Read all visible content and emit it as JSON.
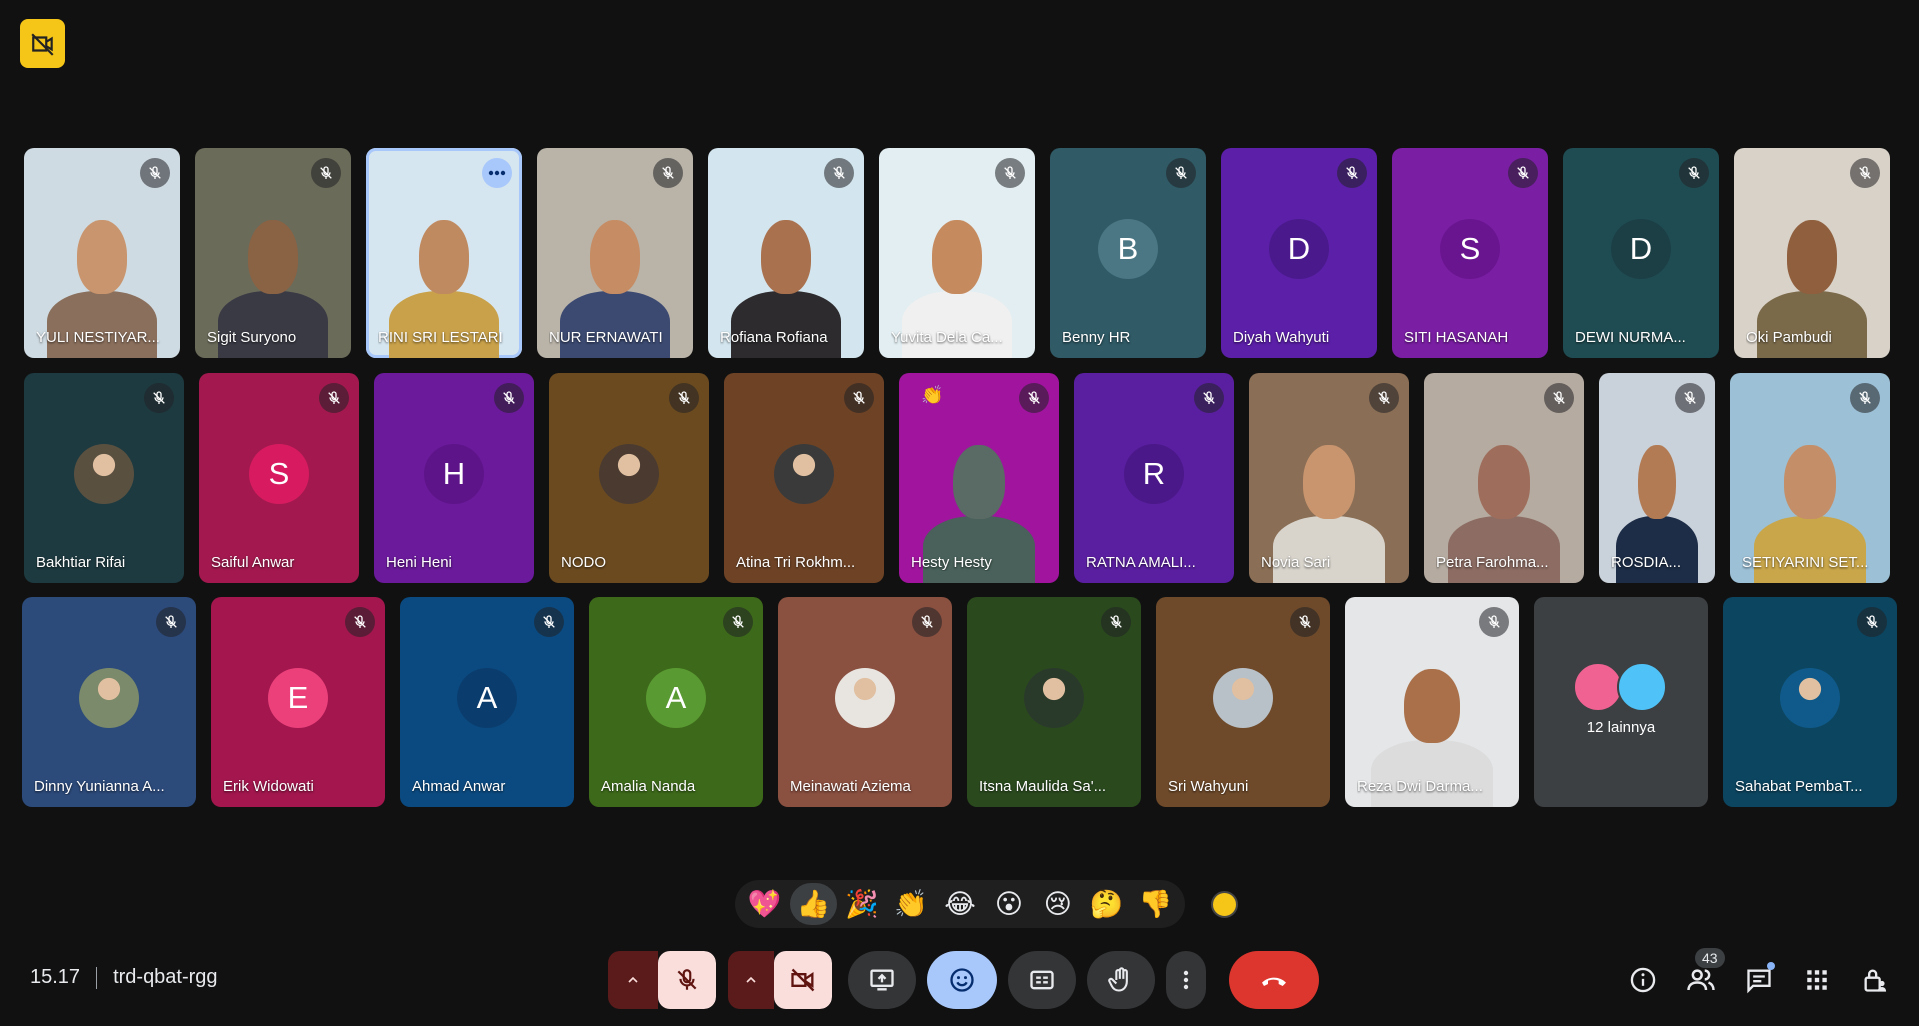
{
  "meeting": {
    "time": "15.17",
    "code": "trd-qbat-rgg"
  },
  "participants_row1": [
    {
      "name": "YULI NESTIYAR...",
      "kind": "video",
      "bg": "#cfdbe2",
      "skin": "#c9956e",
      "cloth": "#8a6f5c"
    },
    {
      "name": "Sigit Suryono",
      "kind": "video",
      "bg": "#6b6b5a",
      "skin": "#8a6244",
      "cloth": "#3a3a45"
    },
    {
      "name": "RINI SRI LESTARI",
      "kind": "video",
      "bg": "#d6e6f0",
      "skin": "#c08a60",
      "cloth": "#c9a14a",
      "active": true
    },
    {
      "name": "NUR ERNAWATI",
      "kind": "video",
      "bg": "#b9b3a8",
      "skin": "#c68c63",
      "cloth": "#3c4a72"
    },
    {
      "name": "Rofiana Rofiana",
      "kind": "video",
      "bg": "#d3e5ee",
      "skin": "#a9714e",
      "cloth": "#2d2b2d"
    },
    {
      "name": "Yuvita Dela Ca...",
      "kind": "video",
      "bg": "#e2eef2",
      "skin": "#c68a5f",
      "cloth": "#f0f0f0"
    },
    {
      "name": "Benny HR",
      "kind": "letter",
      "letter": "B",
      "bg": "#2f5a66",
      "avatar": "#4b7683"
    },
    {
      "name": "Diyah Wahyuti",
      "kind": "letter",
      "letter": "D",
      "bg": "#5b1fa8",
      "avatar": "#4a1a8c"
    },
    {
      "name": "SITI HASANAH",
      "kind": "letter",
      "letter": "S",
      "bg": "#7a1ea3",
      "avatar": "#6a1590"
    },
    {
      "name": "DEWI NURMA...",
      "kind": "letter",
      "letter": "D",
      "bg": "#1f4c52",
      "avatar": "#1b3f45"
    },
    {
      "name": "Oki Pambudi",
      "kind": "video",
      "bg": "#d9d2c8",
      "skin": "#8f5f3e",
      "cloth": "#7a6a4a"
    }
  ],
  "participants_row2": [
    {
      "name": "Bakhtiar Rifai",
      "kind": "photo",
      "bg": "#1d3a40",
      "photo": "#5a5040"
    },
    {
      "name": "Saiful Anwar",
      "kind": "letter",
      "letter": "S",
      "bg": "#a3194f",
      "avatar": "#d81b60"
    },
    {
      "name": "Heni Heni",
      "kind": "letter",
      "letter": "H",
      "bg": "#6a1a9a",
      "avatar": "#5e1489"
    },
    {
      "name": "NODO",
      "kind": "photo",
      "bg": "#6b4a1f",
      "photo": "#4a3a30"
    },
    {
      "name": "Atina Tri Rokhm...",
      "kind": "photo",
      "bg": "#6e4325",
      "photo": "#3a3a3a"
    },
    {
      "name": "Hesty Hesty",
      "kind": "video",
      "bg": "#a0149e",
      "skin": "#5a6a64",
      "cloth": "#49615a",
      "hand": true
    },
    {
      "name": "RATNA AMALI...",
      "kind": "letter",
      "letter": "R",
      "bg": "#5a1fa0",
      "avatar": "#4a1888"
    },
    {
      "name": "Novia Sari",
      "kind": "video",
      "bg": "#8a6e55",
      "skin": "#c9956e",
      "cloth": "#d8d4cc"
    },
    {
      "name": "Petra Farohma...",
      "kind": "video",
      "bg": "#b5aba0",
      "skin": "#9f6d5b",
      "cloth": "#8c6c63"
    },
    {
      "name": "ROSDIA...",
      "kind": "video",
      "bg": "#c9d1da",
      "skin": "#b37b54",
      "cloth": "#1d2d47"
    },
    {
      "name": "SETIYARINI SET...",
      "kind": "video",
      "bg": "#9cc0d6",
      "skin": "#c48f68",
      "cloth": "#c9a64a"
    }
  ],
  "participants_row3": [
    {
      "name": "Dinny Yunianna A...",
      "kind": "photo",
      "bg": "#2c4a7a",
      "photo": "#7a8a6a"
    },
    {
      "name": "Erik Widowati",
      "kind": "letter",
      "letter": "E",
      "bg": "#a3174e",
      "avatar": "#ec407a"
    },
    {
      "name": "Ahmad Anwar",
      "kind": "letter",
      "letter": "A",
      "bg": "#0b4a80",
      "avatar": "#0a3d6e"
    },
    {
      "name": "Amalia Nanda",
      "kind": "letter",
      "letter": "A",
      "bg": "#3d6a1a",
      "avatar": "#5a9a32"
    },
    {
      "name": "Meinawati Aziema",
      "kind": "photo",
      "bg": "#8a5040",
      "photo": "#e8e4e0"
    },
    {
      "name": "Itsna Maulida Sa'...",
      "kind": "photo",
      "bg": "#2a4a1e",
      "photo": "#2a3a2a"
    },
    {
      "name": "Sri Wahyuni",
      "kind": "photo",
      "bg": "#6e4a2a",
      "photo": "#b8c0c8"
    },
    {
      "name": "Reza Dwi Darma...",
      "kind": "video",
      "bg": "#e4e6e8",
      "skin": "#a97049",
      "cloth": "#dcdcdc"
    },
    {
      "name": "12 lainnya",
      "kind": "others"
    },
    {
      "name": "Sahabat PembaT...",
      "kind": "photo",
      "bg": "#0c4560",
      "photo": "#0f5a8a"
    }
  ],
  "others": {
    "label": "12 lainnya",
    "avatar_colors": [
      "#f06292",
      "#4fc3f7"
    ]
  },
  "reactions": [
    {
      "emoji": "💖",
      "name": "sparkling-heart"
    },
    {
      "emoji": "👍",
      "name": "thumbs-up",
      "selected": true
    },
    {
      "emoji": "🎉",
      "name": "party-popper"
    },
    {
      "emoji": "👏",
      "name": "clapping-hands"
    },
    {
      "emoji": "😂",
      "name": "tears-of-joy"
    },
    {
      "emoji": "😮",
      "name": "surprised-face"
    },
    {
      "emoji": "😢",
      "name": "crying-face"
    },
    {
      "emoji": "🤔",
      "name": "thinking-face"
    },
    {
      "emoji": "👎",
      "name": "thumbs-down"
    }
  ],
  "people_count": "43",
  "colors": {
    "background": "#111111",
    "end_call": "#dc362e",
    "active_button": "#a8c7fa",
    "muted_button": "#f9dedc"
  }
}
